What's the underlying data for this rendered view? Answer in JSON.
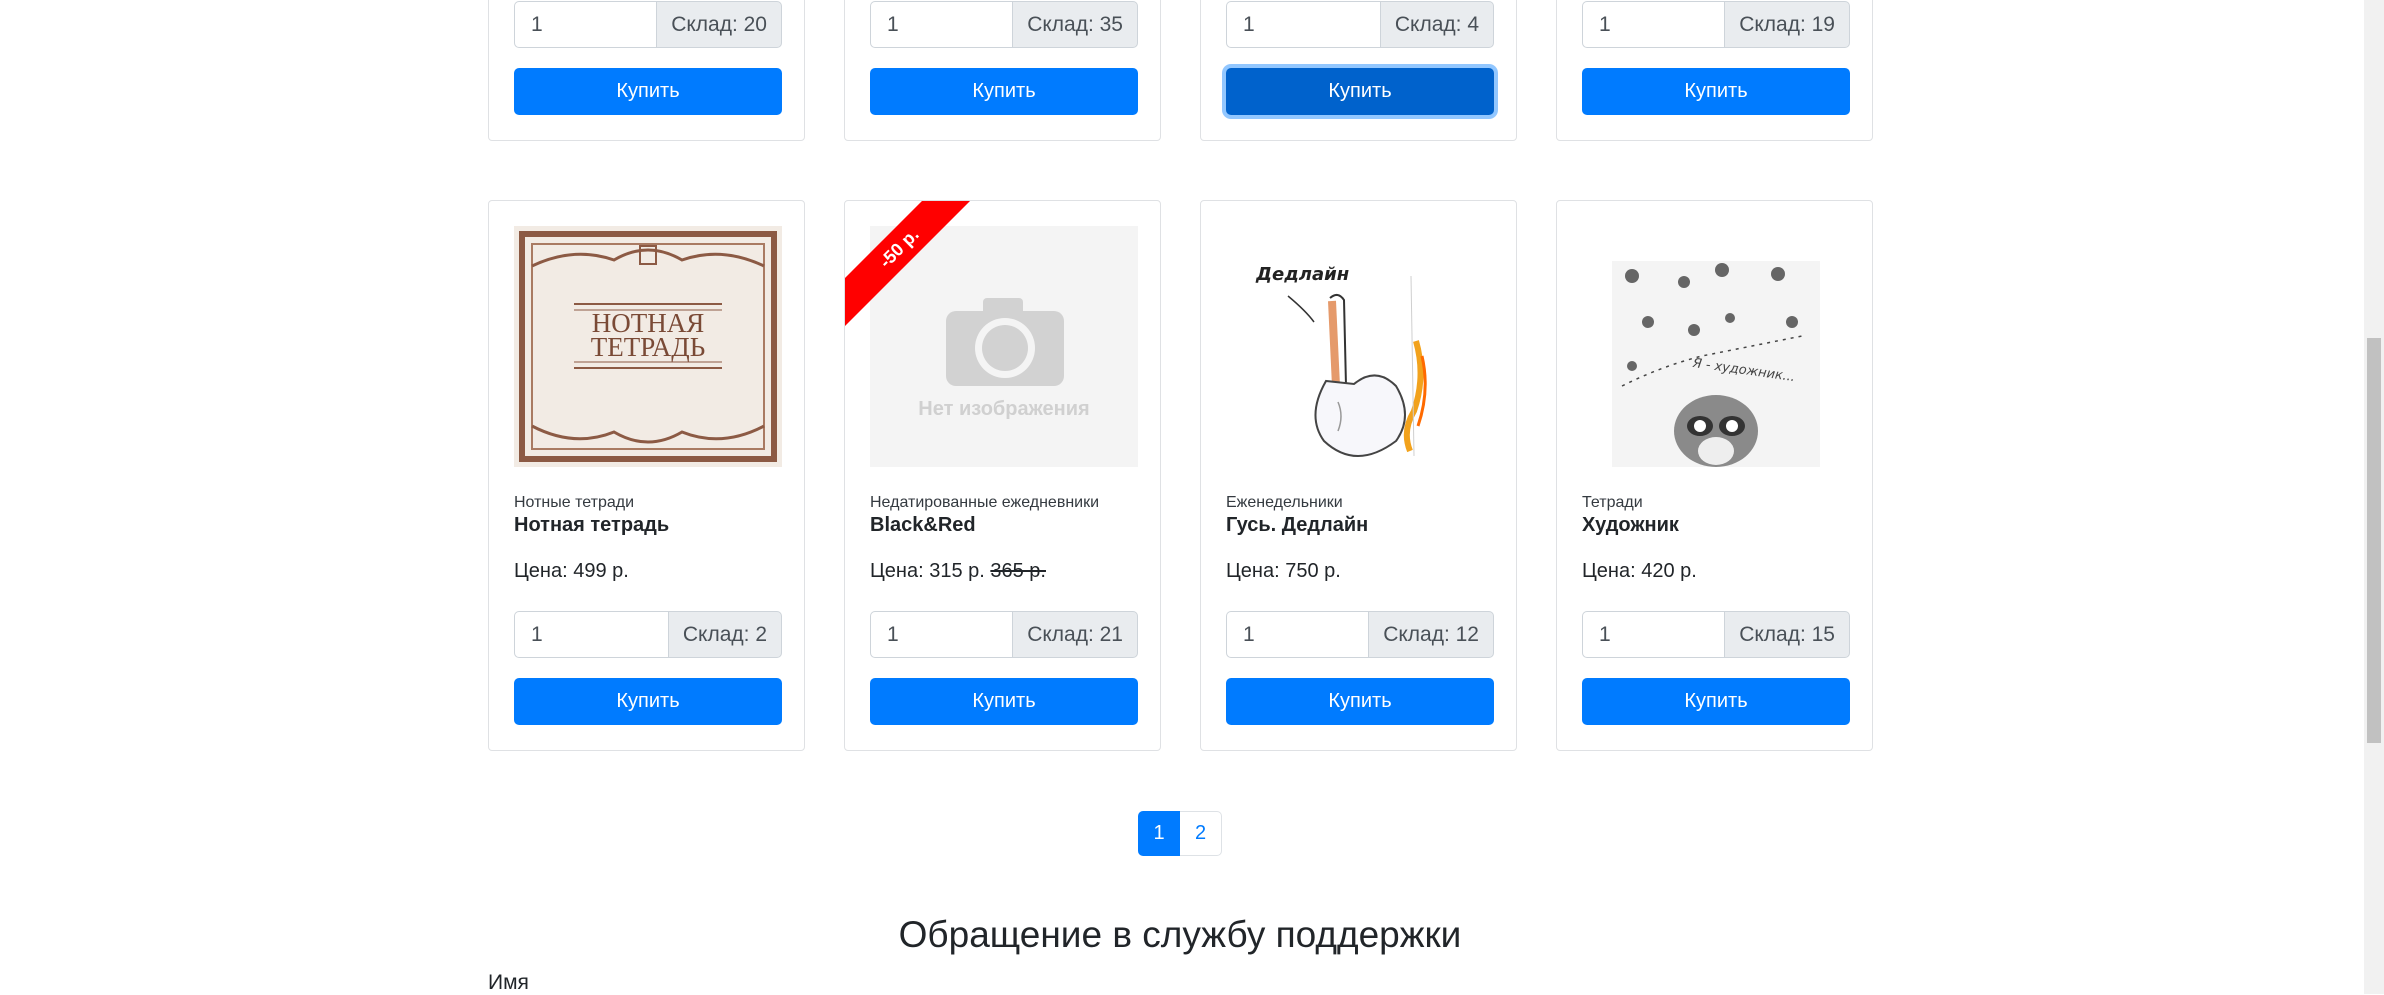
{
  "colors": {
    "primary": "#007bff",
    "primary_focus": "#0062cc",
    "ribbon": "#ff0000",
    "stock_bg": "#e9ecef"
  },
  "top_row": [
    {
      "qty": "1",
      "stock": "Склад: 20",
      "buy_label": "Купить"
    },
    {
      "qty": "1",
      "stock": "Склад: 35",
      "buy_label": "Купить"
    },
    {
      "qty": "1",
      "stock": "Склад: 4",
      "buy_label": "Купить"
    },
    {
      "qty": "1",
      "stock": "Склад: 19",
      "buy_label": "Купить"
    }
  ],
  "products": [
    {
      "category": "Нотные тетради",
      "title": "Нотная тетрадь",
      "price_label": "Цена: 499 р.",
      "price_old": "",
      "qty": "1",
      "stock": "Склад: 2",
      "buy_label": "Купить",
      "image": {
        "line1": "НОТНАЯ",
        "line2": "ТЕТРАДЬ"
      }
    },
    {
      "category": "Недатированные ежедневники",
      "title": "Black&Red",
      "price_label": "Цена: 315 р. ",
      "price_old": "365 р.",
      "qty": "1",
      "stock": "Склад: 21",
      "buy_label": "Купить",
      "ribbon": "-50 р.",
      "image": {
        "placeholder_text": "Нет изображения"
      }
    },
    {
      "category": "Еженедельники",
      "title": "Гусь. Дедлайн",
      "price_label": "Цена: 750 р.",
      "price_old": "",
      "qty": "1",
      "stock": "Склад: 12",
      "buy_label": "Купить",
      "image": {
        "caption": "Дедлайн"
      }
    },
    {
      "category": "Тетради",
      "title": "Художник",
      "price_label": "Цена: 420 р.",
      "price_old": "",
      "qty": "1",
      "stock": "Склад: 15",
      "buy_label": "Купить",
      "image": {
        "caption": "Я - художник..."
      }
    }
  ],
  "pagination": {
    "pages": [
      "1",
      "2"
    ],
    "active": "1"
  },
  "support": {
    "title": "Обращение в службу поддержки",
    "name_label": "Имя"
  }
}
